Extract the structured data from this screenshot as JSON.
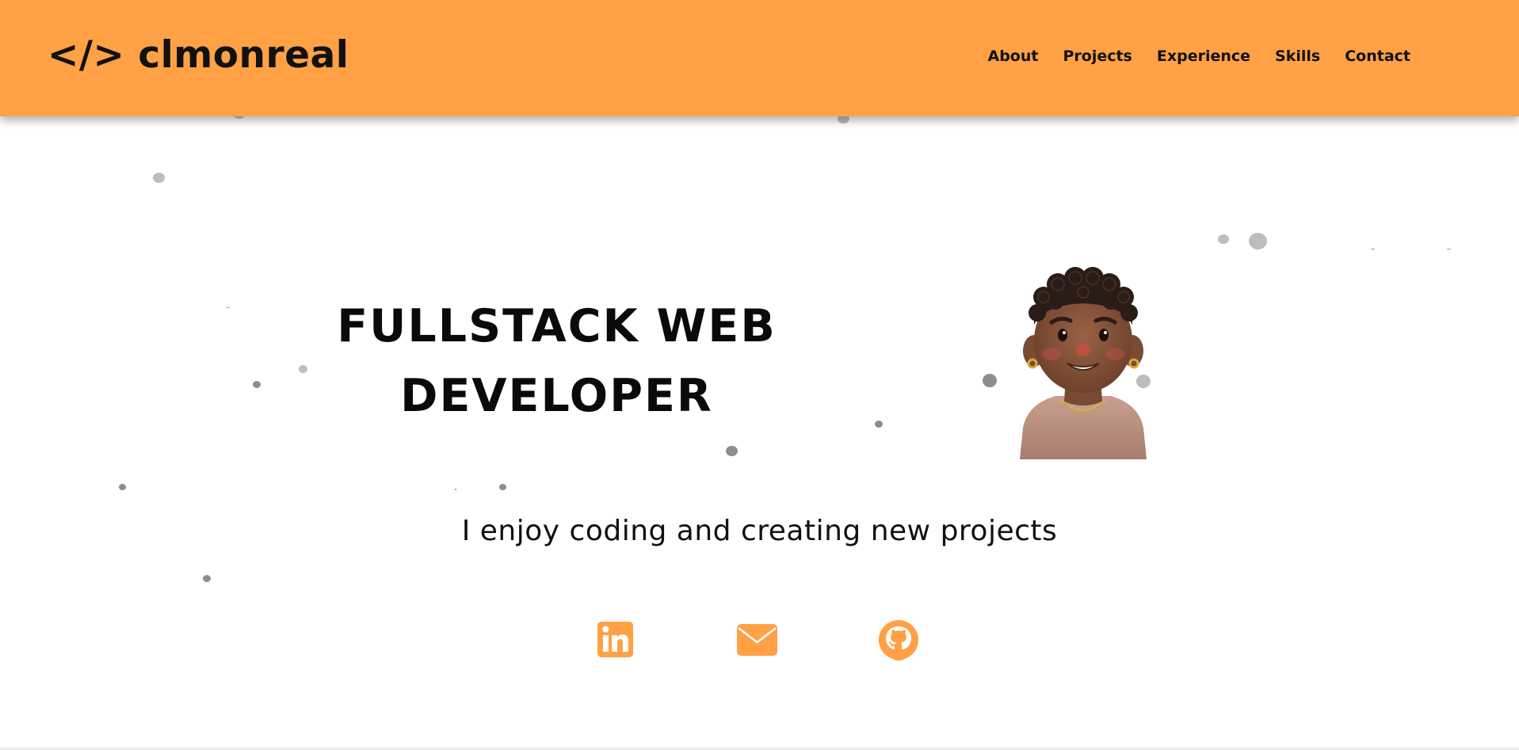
{
  "header": {
    "logo": "</> clmonreal",
    "nav": [
      "About",
      "Projects",
      "Experience",
      "Skills",
      "Contact"
    ]
  },
  "hero": {
    "title_line1": "FULLSTACK WEB",
    "title_line2": "DEVELOPER",
    "tagline": "I enjoy coding and creating new projects"
  },
  "socials": [
    {
      "name": "LinkedIn",
      "icon": "linkedin-icon"
    },
    {
      "name": "Email",
      "icon": "envelope-icon"
    },
    {
      "name": "GitHub",
      "icon": "github-icon"
    }
  ],
  "colors": {
    "accent": "#ffa144",
    "text": "#111111",
    "background": "#ffffff",
    "particle": "#bdbdbd"
  }
}
